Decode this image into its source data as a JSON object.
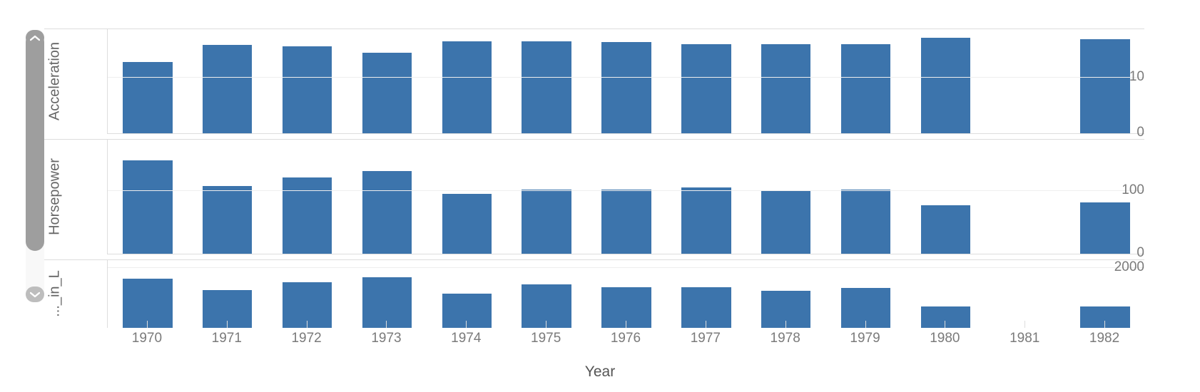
{
  "chart_data": {
    "type": "bar",
    "title": "",
    "xlabel": "Year",
    "categories": [
      "1970",
      "1971",
      "1972",
      "1973",
      "1974",
      "1975",
      "1976",
      "1977",
      "1978",
      "1979",
      "1980",
      "1981",
      "1982"
    ],
    "grid": true,
    "legend_position": "none",
    "bar_color": "#3c74ac",
    "panels": [
      {
        "ylabel": "Acceleration",
        "ylim": [
          0,
          18.5
        ],
        "yticks": [
          0,
          10
        ],
        "ytick_labels": [
          "0",
          "10"
        ],
        "values": [
          12.6,
          15.6,
          15.4,
          14.3,
          16.2,
          16.2,
          16.1,
          15.7,
          15.8,
          15.8,
          16.9,
          null,
          16.6
        ]
      },
      {
        "ylabel": "Horsepower",
        "ylim": [
          0,
          180
        ],
        "yticks": [
          0,
          100
        ],
        "ytick_labels": [
          "0",
          "100"
        ],
        "values": [
          147,
          107,
          120,
          130,
          94,
          101,
          101,
          105,
          99,
          101,
          77,
          null,
          81
        ]
      },
      {
        "ylabel": "Weight_in_L...",
        "ylabel_truncated": "..._in_L",
        "ylim": [
          0,
          4000
        ],
        "yticks": [
          2000
        ],
        "ytick_labels": [
          "2000"
        ],
        "values": [
          3372,
          2995,
          3237,
          3420,
          2878,
          3176,
          3078,
          3086,
          2955,
          3056,
          2437,
          null,
          2453
        ]
      }
    ]
  },
  "scrollbar": {
    "up_icon": "chevron-up-icon",
    "down_icon": "chevron-down-icon",
    "orientation": "vertical"
  }
}
